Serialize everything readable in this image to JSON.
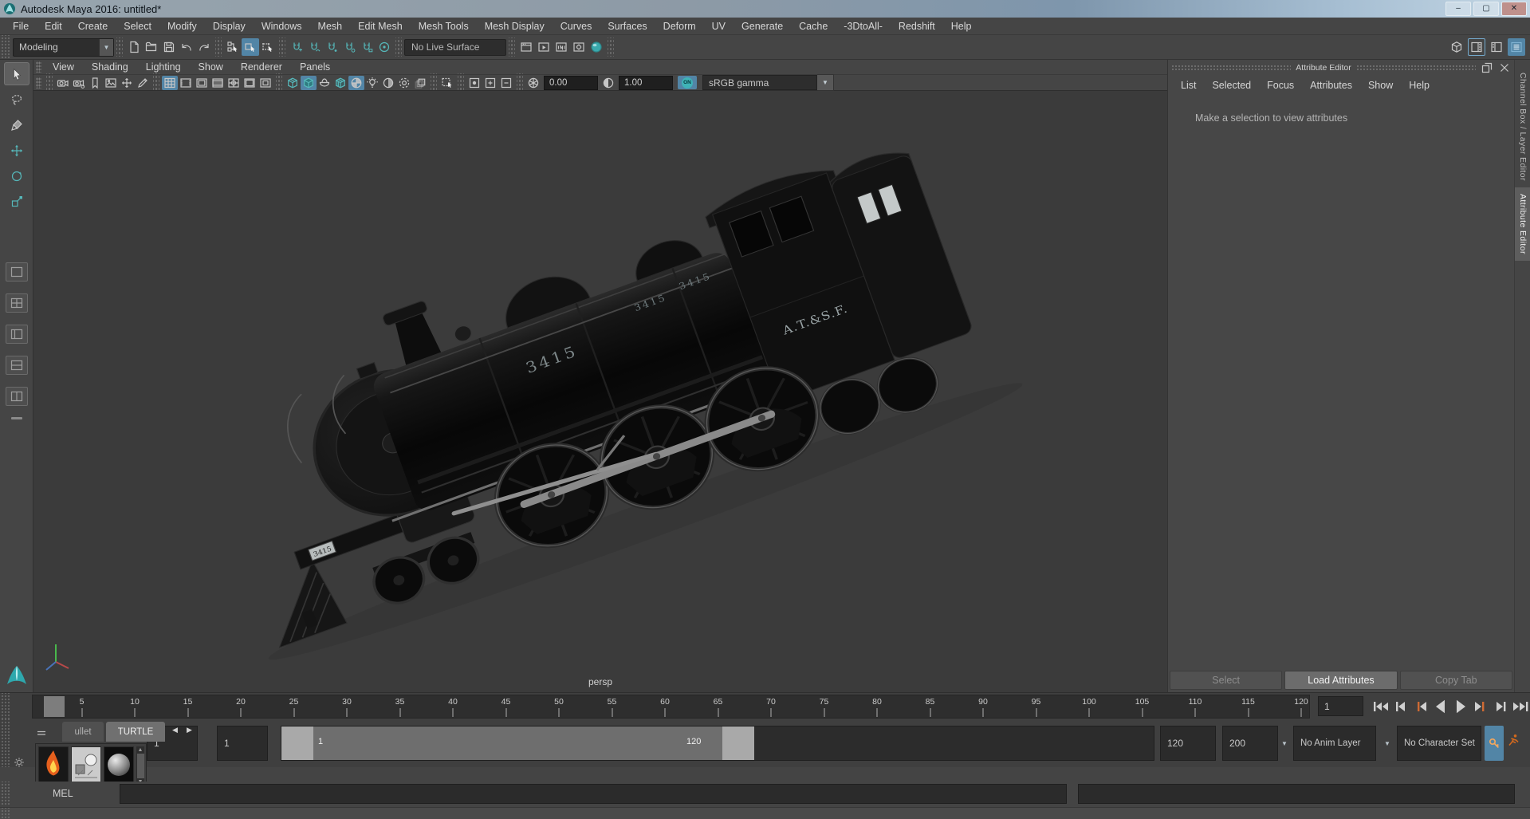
{
  "window": {
    "title": "Autodesk Maya 2016: untitled*"
  },
  "window_buttons": [
    {
      "name": "minimize",
      "glyph": "–"
    },
    {
      "name": "maximize",
      "glyph": "▢"
    },
    {
      "name": "close",
      "glyph": "✕"
    }
  ],
  "menu_bar": [
    "File",
    "Edit",
    "Create",
    "Select",
    "Modify",
    "Display",
    "Windows",
    "Mesh",
    "Edit Mesh",
    "Mesh Tools",
    "Mesh Display",
    "Curves",
    "Surfaces",
    "Deform",
    "UV",
    "Generate",
    "Cache",
    "-3DtoAll-",
    "Redshift",
    "Help"
  ],
  "status_line": {
    "menuset": "Modeling",
    "groups": [
      [
        {
          "name": "new-scene"
        },
        {
          "name": "open-scene"
        },
        {
          "name": "save-scene"
        },
        {
          "name": "undo"
        },
        {
          "name": "redo"
        }
      ],
      [
        {
          "name": "select-by-hierarchy"
        },
        {
          "name": "select-by-object",
          "active": true
        },
        {
          "name": "select-by-component"
        }
      ],
      [
        {
          "name": "snap-to-grid"
        },
        {
          "name": "snap-to-curve"
        },
        {
          "name": "snap-to-point"
        },
        {
          "name": "snap-to-projected-center"
        },
        {
          "name": "snap-to-view-plane"
        },
        {
          "name": "make-live"
        }
      ],
      [
        {
          "name": "live-surface-field",
          "field": "No Live Surface"
        }
      ],
      [
        {
          "name": "render-view"
        },
        {
          "name": "render-current-frame"
        },
        {
          "name": "ipr-render"
        },
        {
          "name": "render-settings"
        },
        {
          "name": "render-launch"
        }
      ]
    ],
    "right_icons": [
      {
        "name": "workspace"
      },
      {
        "name": "attribute-editor-toggle",
        "border": true
      },
      {
        "name": "tool-settings-toggle"
      },
      {
        "name": "channel-box-toggle",
        "active": true
      }
    ]
  },
  "toolbox": {
    "tools": [
      {
        "name": "select-tool",
        "active": true
      },
      {
        "name": "lasso-tool"
      },
      {
        "name": "paint-select-tool"
      },
      {
        "name": "move-tool"
      },
      {
        "name": "rotate-tool"
      },
      {
        "name": "scale-tool"
      }
    ],
    "layouts": [
      {
        "name": "layout-single-pane"
      },
      {
        "name": "layout-four-pane"
      },
      {
        "name": "layout-persp-outliner"
      },
      {
        "name": "layout-split-horizontal"
      },
      {
        "name": "layout-split-vertical"
      }
    ]
  },
  "panel_menu": [
    "View",
    "Shading",
    "Lighting",
    "Show",
    "Renderer",
    "Panels"
  ],
  "view_bar": {
    "groups": [
      [
        {
          "name": "camera"
        },
        {
          "name": "camera-settings"
        },
        {
          "name": "bookmark"
        },
        {
          "name": "image-plane"
        },
        {
          "name": "pan-zoom"
        },
        {
          "name": "grease-pencil"
        }
      ],
      [
        {
          "name": "grid",
          "active": true
        },
        {
          "name": "film-gate"
        },
        {
          "name": "resolution-gate"
        },
        {
          "name": "gate-mask"
        },
        {
          "name": "field-chart"
        },
        {
          "name": "safe-action"
        },
        {
          "name": "safe-title"
        }
      ],
      [
        {
          "name": "wireframe"
        },
        {
          "name": "shaded",
          "active": true
        },
        {
          "name": "use-default-material"
        },
        {
          "name": "wireframe-on-shaded"
        },
        {
          "name": "textured",
          "active": true
        },
        {
          "name": "lights"
        },
        {
          "name": "shadows"
        },
        {
          "name": "screen-space-ao"
        },
        {
          "name": "motion-blur"
        }
      ],
      [
        {
          "name": "highlight-selection"
        }
      ],
      [
        {
          "name": "isolate-selected"
        },
        {
          "name": "isolate-add"
        },
        {
          "name": "isolate-remove"
        }
      ]
    ],
    "exposure": "0.00",
    "contrast": "1.00",
    "gamma_on": "ON",
    "gamma_label": "sRGB gamma"
  },
  "viewport": {
    "camera": "persp",
    "loco": {
      "number": "3415",
      "railroad": "A.T.&S.F.",
      "plate": "3415"
    }
  },
  "attribute_editor": {
    "title": "Attribute Editor",
    "menu": [
      "List",
      "Selected",
      "Focus",
      "Attributes",
      "Show",
      "Help"
    ],
    "message": "Make a selection to view attributes",
    "footer": [
      {
        "label": "Select"
      },
      {
        "label": "Load Attributes",
        "active": true
      },
      {
        "label": "Copy Tab"
      }
    ]
  },
  "side_tabs": [
    {
      "label": "Channel Box / Layer Editor"
    },
    {
      "label": "Attribute Editor",
      "active": true
    }
  ],
  "timeline": {
    "current": "1",
    "frame_field": "1",
    "ticks": [
      5,
      10,
      15,
      20,
      25,
      30,
      35,
      40,
      45,
      50,
      55,
      60,
      65,
      70,
      75,
      80,
      85,
      90,
      95,
      100,
      105,
      110,
      115,
      120
    ]
  },
  "playback": [
    {
      "name": "go-to-start"
    },
    {
      "name": "step-back-frame"
    },
    {
      "name": "step-back-key"
    },
    {
      "name": "play-backwards"
    },
    {
      "name": "play-forwards"
    },
    {
      "name": "step-forward-key"
    },
    {
      "name": "step-forward-frame"
    },
    {
      "name": "go-to-end"
    }
  ],
  "range_slider": {
    "anim_start": "1",
    "playback_start": "1",
    "handle_start_label": "1",
    "handle_end_label": "120",
    "playback_end": "120",
    "anim_end": "200",
    "anim_layer": "No Anim Layer",
    "character_set": "No Character Set"
  },
  "shelf": {
    "tabs": [
      {
        "label": "ullet"
      },
      {
        "label": "TURTLE",
        "active": true
      }
    ],
    "items": [
      {
        "name": "turtle-flame"
      },
      {
        "name": "turtle-bake"
      },
      {
        "name": "turtle-sphere"
      }
    ]
  },
  "command_line": {
    "label": "MEL"
  },
  "colors": {
    "accent_blue": "#5285a6",
    "teal": "#3fb3b7",
    "key_orange": "#cf6a33",
    "viewport_bg": "#3b3b3b"
  }
}
